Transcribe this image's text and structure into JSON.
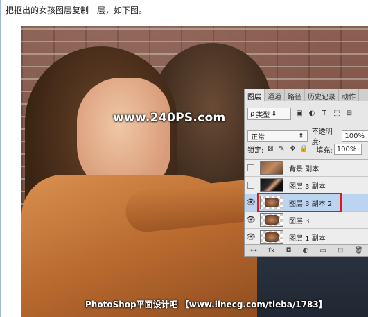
{
  "caption": "把抠出的女孩图层复制一层，如下图。",
  "watermark": {
    "top": "www.240PS.com",
    "bottom": "PhotoShop平面设计吧 【www.linecg.com/tieba/1783】"
  },
  "layers_panel": {
    "tabs": [
      "图层",
      "通道",
      "路径",
      "历史记录",
      "动作"
    ],
    "filter": {
      "search_icon": "ρ",
      "kind_label": "类型"
    },
    "filter_icons": [
      "image-filter-icon",
      "adjustment-filter-icon",
      "text-filter-icon",
      "shape-filter-icon",
      "smart-object-filter-icon"
    ],
    "blend_mode": "正常",
    "opacity_label": "不透明度:",
    "opacity_value": "100%",
    "lock_label": "锁定:",
    "fill_label": "填充:",
    "fill_value": "100%",
    "layers": [
      {
        "name": "背景 副本",
        "visible": false,
        "thumb": "photo1"
      },
      {
        "name": "图层 3 副本",
        "visible": false,
        "thumb": "cut"
      },
      {
        "name": "图层 3 副本 2",
        "visible": true,
        "thumb": "check",
        "selected": true
      },
      {
        "name": "图层 3",
        "visible": true,
        "thumb": "check"
      },
      {
        "name": "图层 1 副本",
        "visible": true,
        "thumb": "check"
      }
    ],
    "footer_icons": [
      "link-icon",
      "fx-icon",
      "mask-icon",
      "adjustment-icon",
      "folder-icon",
      "new-layer-icon",
      "delete-icon"
    ],
    "footer_glyphs": [
      "⊶",
      "fx",
      "◘",
      "◐",
      "▭",
      "⊡",
      "🗑"
    ]
  },
  "colors": {
    "selected_layer": "#bcd4ef",
    "highlight_border": "#e01818"
  }
}
